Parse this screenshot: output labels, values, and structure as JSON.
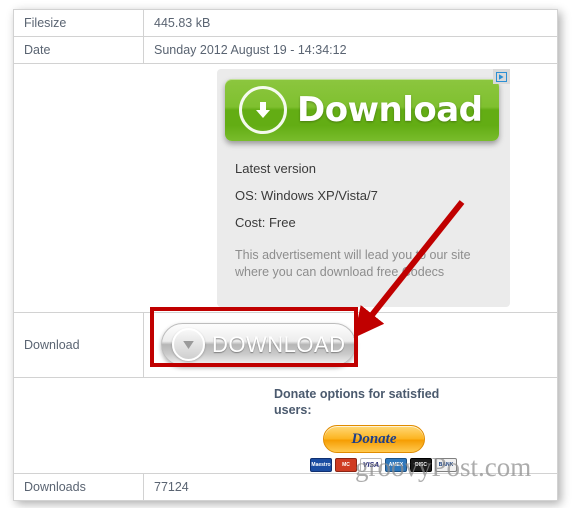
{
  "table": {
    "rows": [
      {
        "label": "Filesize",
        "value": "445.83 kB"
      },
      {
        "label": "Date",
        "value": "Sunday 2012 August 19 - 14:34:12"
      }
    ],
    "download_label": "Download",
    "downloads_label": "Downloads",
    "downloads_value": "77124"
  },
  "advertisement": {
    "adchoices_icon": "adchoices-triangle-icon",
    "green_button": {
      "label": "Download",
      "icon": "download-circle-arrow-icon",
      "color": "#63ad14"
    },
    "lines": [
      "Latest version",
      "OS: Windows XP/Vista/7",
      "Cost: Free"
    ],
    "disclaimer": "This advertisement will lead you to our site where you can download free Codecs"
  },
  "real_download_button": {
    "label": "DOWNLOAD",
    "icon": "download-circle-arrow-icon",
    "highlight_color": "#c00000"
  },
  "donate": {
    "heading": "Donate options for satisfied users:",
    "button_label": "Donate",
    "cards": [
      {
        "name": "maestro-card-icon",
        "text": "Maestro"
      },
      {
        "name": "mastercard-card-icon",
        "text": "MC"
      },
      {
        "name": "visa-card-icon",
        "text": "VISA"
      },
      {
        "name": "amex-card-icon",
        "text": "AMEX"
      },
      {
        "name": "discover-card-icon",
        "text": "DISC"
      },
      {
        "name": "bank-card-icon",
        "text": "BANK"
      }
    ]
  },
  "annotation": {
    "arrow_color": "#c00000",
    "arrow_name": "red-pointer-arrow"
  },
  "watermark": {
    "text": "groovyPost.com"
  }
}
